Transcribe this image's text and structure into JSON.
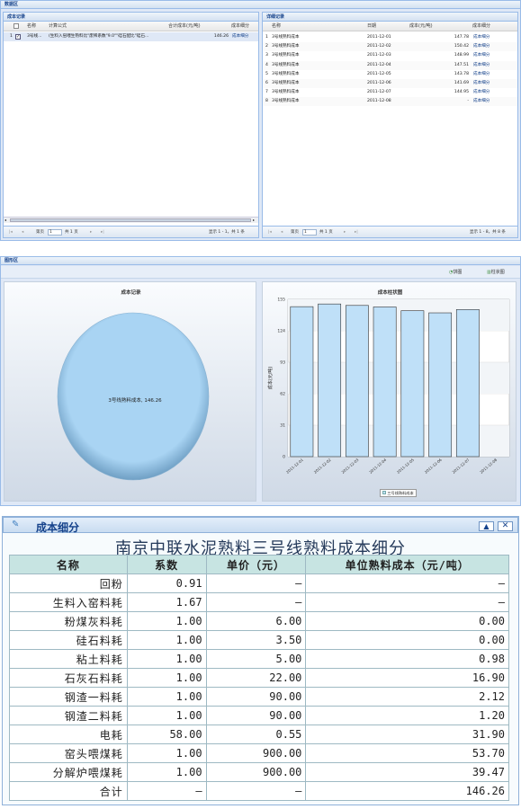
{
  "top_panel": {
    "title": "数据区",
    "left": {
      "title": "成本记录",
      "columns": [
        "名称",
        "计算公式",
        "合计成本(元/吨)",
        "成本细分"
      ],
      "rows": [
        {
          "num": "1",
          "name": "3号线...",
          "formula": "(生料入窑喂生熟料比\"废稀系数\"9.0\"\"硅石配比\"硅石...",
          "total": "146.26",
          "link": "成本细分"
        }
      ],
      "pager": {
        "page_label": "第页",
        "page_value": "1",
        "total_pages": "共 1 页",
        "display": "显示 1 - 1，共 1 条"
      }
    },
    "right": {
      "title": "详细记录",
      "columns": [
        "名称",
        "日期",
        "成本(元/吨)",
        "成本细分"
      ],
      "rows": [
        {
          "num": "1",
          "name": "3号线熟料成本",
          "date": "2011-12-01",
          "cost": "147.78",
          "link": "成本细分"
        },
        {
          "num": "2",
          "name": "3号线熟料成本",
          "date": "2011-12-02",
          "cost": "150.42",
          "link": "成本细分"
        },
        {
          "num": "3",
          "name": "3号线熟料成本",
          "date": "2011-12-03",
          "cost": "148.99",
          "link": "成本细分"
        },
        {
          "num": "4",
          "name": "3号线熟料成本",
          "date": "2011-12-04",
          "cost": "147.51",
          "link": "成本细分"
        },
        {
          "num": "5",
          "name": "3号线熟料成本",
          "date": "2011-12-05",
          "cost": "143.78",
          "link": "成本细分"
        },
        {
          "num": "6",
          "name": "3号线熟料成本",
          "date": "2011-12-06",
          "cost": "141.69",
          "link": "成本细分"
        },
        {
          "num": "7",
          "name": "3号线熟料成本",
          "date": "2011-12-07",
          "cost": "144.95",
          "link": "成本细分"
        },
        {
          "num": "8",
          "name": "3号线熟料成本",
          "date": "2011-12-08",
          "cost": "-",
          "link": "成本细分"
        }
      ],
      "pager": {
        "page_label": "第页",
        "page_value": "1",
        "total_pages": "共 1 页",
        "display": "显示 1 - 8，共 8 条"
      }
    }
  },
  "chart_panel": {
    "title": "图形区",
    "buttons": {
      "pie": "饼图",
      "bar": "柱状图"
    },
    "pie": {
      "title": "成本记录",
      "label": "3号线熟料成本, 146.26",
      "color": "#a9d4f3"
    },
    "bar": {
      "title": "成本柱状图",
      "legend": "三号线熟料成本"
    }
  },
  "chart_data": {
    "type": "bar",
    "title": "成本柱状图",
    "ylabel": "成本(元/吨)",
    "categories": [
      "2011-12-01",
      "2011-12-02",
      "2011-12-03",
      "2011-12-04",
      "2011-12-05",
      "2011-12-06",
      "2011-12-07",
      "2011-12-08"
    ],
    "values": [
      147.78,
      150.42,
      148.99,
      147.51,
      143.78,
      141.69,
      144.95,
      0
    ],
    "ylim": [
      0,
      155
    ],
    "yticks": [
      "0",
      "31",
      "62",
      "93",
      "124",
      "155"
    ],
    "legend": "三号线熟料成本",
    "bar_color": "#bfe0f8"
  },
  "detail_panel": {
    "header": "成本细分",
    "title": "南京中联水泥熟料三号线熟料成本细分",
    "columns": [
      "名称",
      "系数",
      "单价（元）",
      "单位熟料成本（元/吨）"
    ],
    "rows": [
      [
        "回粉",
        "0.91",
        "–",
        "–"
      ],
      [
        "生料入窑料耗",
        "1.67",
        "–",
        "–"
      ],
      [
        "粉煤灰料耗",
        "1.00",
        "6.00",
        "0.00"
      ],
      [
        "硅石料耗",
        "1.00",
        "3.50",
        "0.00"
      ],
      [
        "粘土料耗",
        "1.00",
        "5.00",
        "0.98"
      ],
      [
        "石灰石料耗",
        "1.00",
        "22.00",
        "16.90"
      ],
      [
        "钢渣一料耗",
        "1.00",
        "90.00",
        "2.12"
      ],
      [
        "钢渣二料耗",
        "1.00",
        "90.00",
        "1.20"
      ],
      [
        "电耗",
        "58.00",
        "0.55",
        "31.90"
      ],
      [
        "窑头喂煤耗",
        "1.00",
        "900.00",
        "53.70"
      ],
      [
        "分解炉喂煤耗",
        "1.00",
        "900.00",
        "39.47"
      ],
      [
        "合计",
        "–",
        "–",
        "146.26"
      ]
    ]
  }
}
